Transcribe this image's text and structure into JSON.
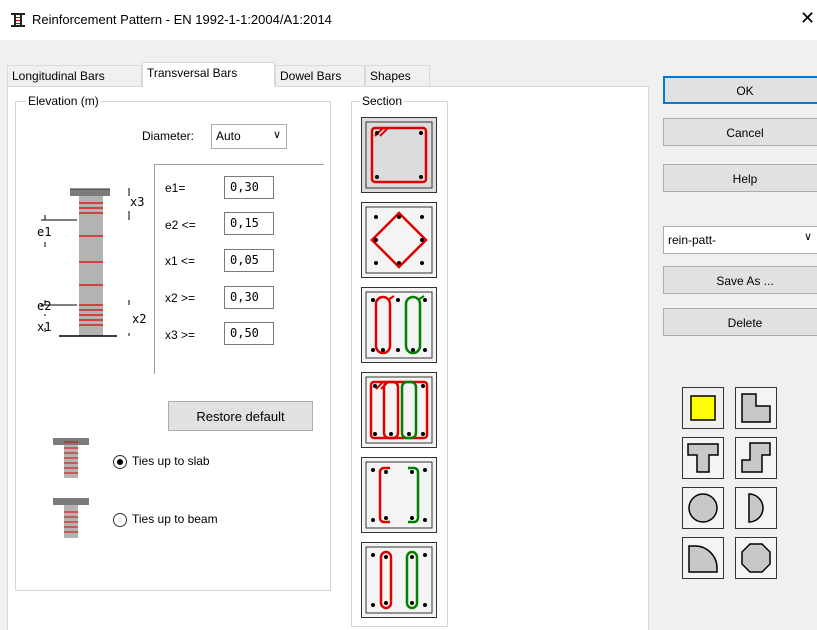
{
  "window": {
    "title": "Reinforcement Pattern - EN 1992-1-1:2004/A1:2014",
    "close_glyph": "✕"
  },
  "tabs": [
    {
      "label": "Longitudinal Bars",
      "active": false
    },
    {
      "label": "Transversal Bars",
      "active": true
    },
    {
      "label": "Dowel Bars",
      "active": false
    },
    {
      "label": "Shapes",
      "active": false
    }
  ],
  "elevation": {
    "title": "Elevation (m)",
    "diameter_label": "Diameter:",
    "diameter_value": "Auto",
    "diagram_labels": {
      "e1": "e1",
      "e2": "e2",
      "x1": "x1",
      "x2": "x2",
      "x3": "x3"
    },
    "params": [
      {
        "label": "e1=",
        "value": "0,30"
      },
      {
        "label": "e2 <=",
        "value": "0,15"
      },
      {
        "label": "x1 <=",
        "value": "0,05"
      },
      {
        "label": "x2 >=",
        "value": "0,30"
      },
      {
        "label": "x3 >=",
        "value": "0,50"
      }
    ],
    "restore_label": "Restore default",
    "radio_options": [
      {
        "label": "Ties up to slab",
        "checked": true
      },
      {
        "label": "Ties up to beam",
        "checked": false
      }
    ]
  },
  "section": {
    "title": "Section",
    "patterns": [
      "square-perimeter-tie",
      "diamond-tie",
      "two-closed-ties",
      "perimeter-plus-closed-ties",
      "two-c-ties",
      "two-hairpin-ties"
    ],
    "selected_index": 0
  },
  "buttons": {
    "ok": "OK",
    "cancel": "Cancel",
    "help": "Help",
    "save_as": "Save As ...",
    "delete": "Delete"
  },
  "preset": {
    "value": "rein-patt-"
  },
  "shapes": {
    "items": [
      "rectangle",
      "l-shape",
      "t-shape",
      "z-shape",
      "circle",
      "half-circle",
      "quarter-circle",
      "octagon"
    ],
    "selected": "rectangle"
  },
  "colors": {
    "tie_red": "#e00000",
    "tie_green": "#008000",
    "selection_yellow": "#ffff00",
    "accent_blue": "#0078d7"
  }
}
